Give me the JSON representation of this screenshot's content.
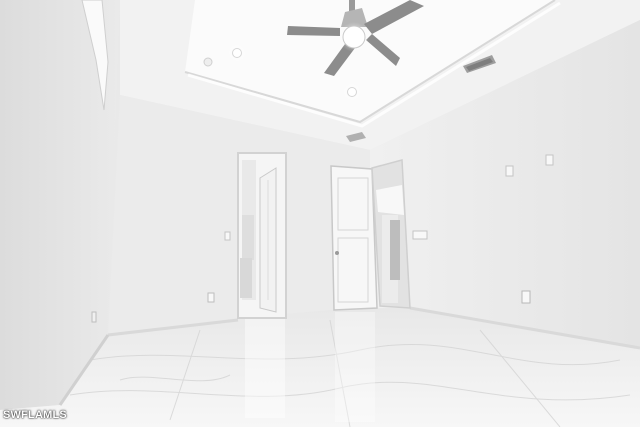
{
  "watermark": {
    "text": "SWFLAMLS"
  },
  "colors": {
    "wall_left": "#e6e6e6",
    "wall_back": "#ededed",
    "wall_right": "#ececec",
    "ceiling": "#f3f3f3",
    "tray": "#fafafa",
    "floor": "#f0f0f0",
    "door": "#f6f6f6",
    "fan_blade": "#8c8c8c"
  },
  "icons": [
    "ceiling-fan-icon",
    "recessed-light-icon",
    "air-vent-icon",
    "door-icon",
    "outlet-icon"
  ]
}
